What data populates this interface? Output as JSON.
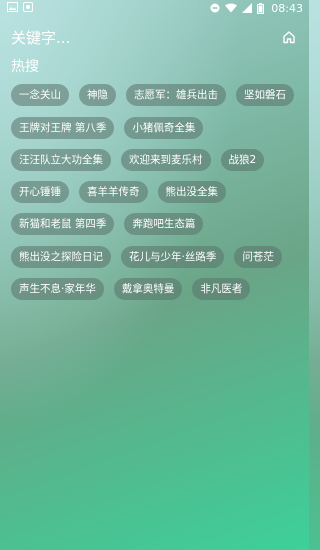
{
  "status_bar": {
    "time": "08:43"
  },
  "header": {
    "search_text": "关键字..."
  },
  "hot": {
    "title": "热搜",
    "rows": [
      [
        "一念关山",
        "神隐",
        "志愿军：雄兵出击",
        "坚如磐石"
      ],
      [
        "王牌对王牌 第八季",
        "小猪佩奇全集"
      ],
      [
        "汪汪队立大功全集",
        "欢迎来到麦乐村",
        "战狼2"
      ],
      [
        "开心锤锤",
        "喜羊羊传奇",
        "熊出没全集"
      ],
      [
        "新猫和老鼠 第四季",
        "奔跑吧生态篇"
      ],
      [
        "熊出没之探险日记",
        "花儿与少年·丝路季",
        "问苍茫"
      ],
      [
        "声生不息·家年华",
        "戴拿奥特曼",
        "非凡医者"
      ]
    ]
  }
}
